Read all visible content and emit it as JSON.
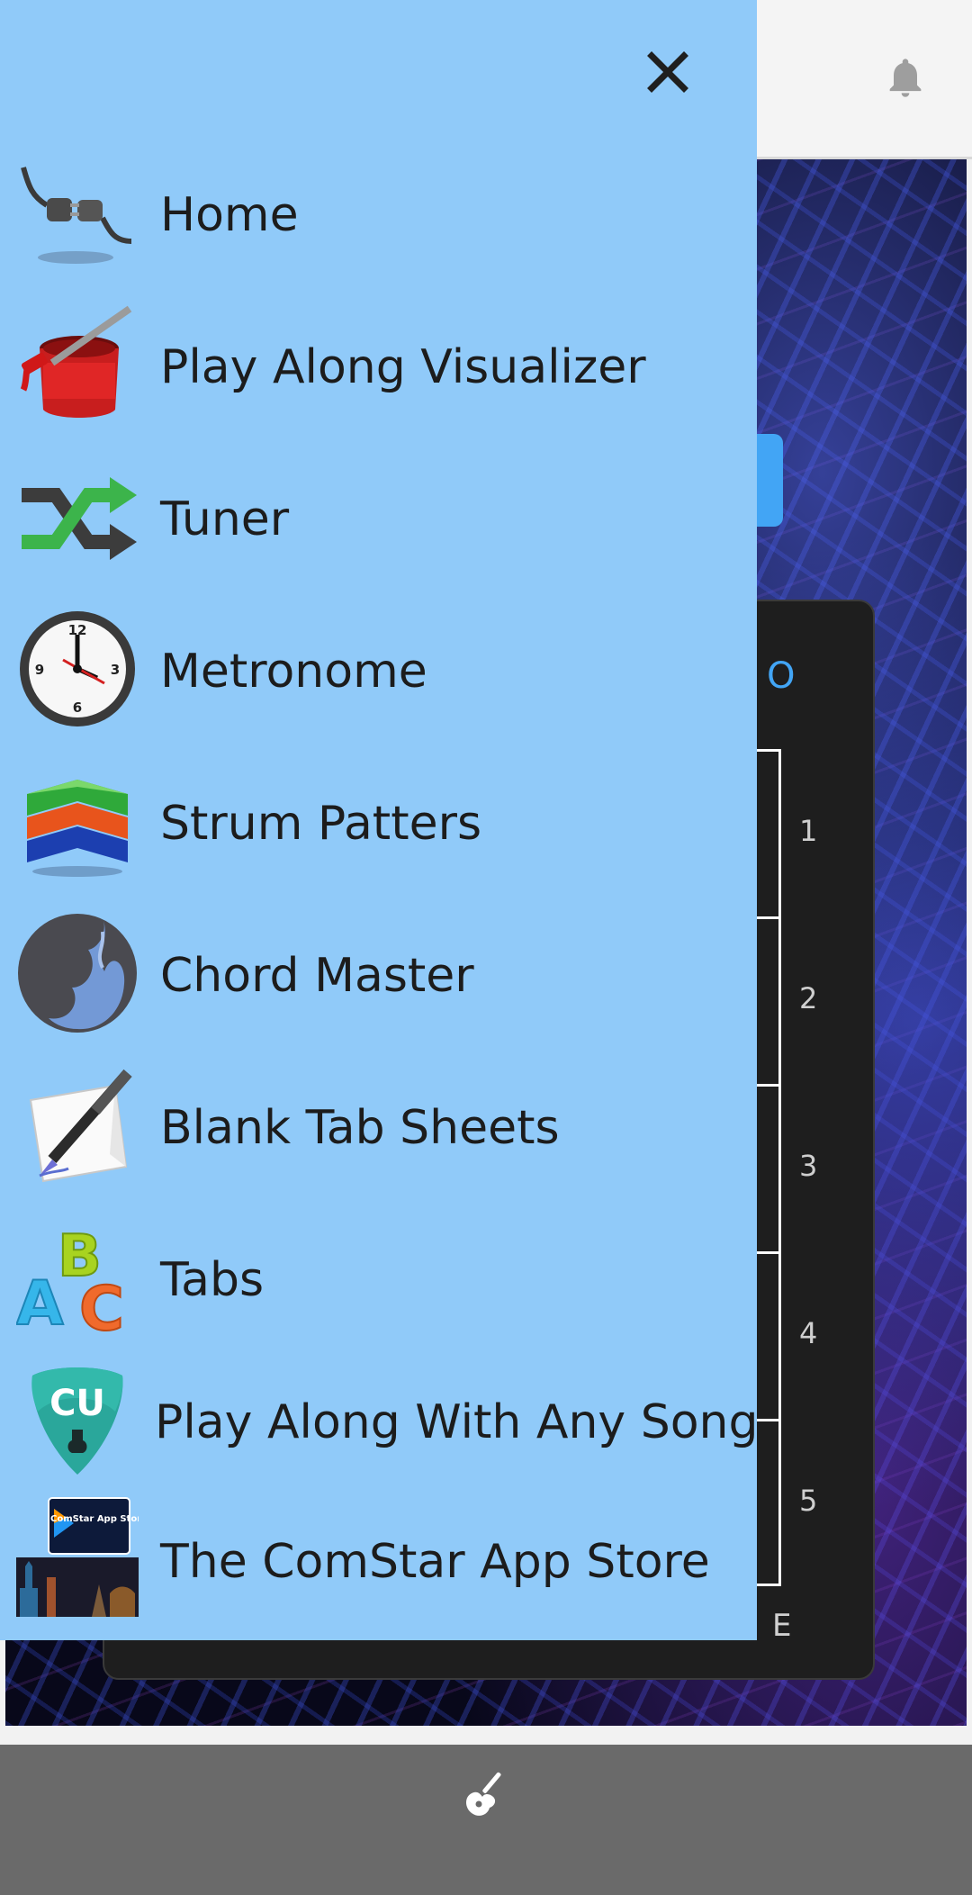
{
  "drawer": {
    "close_icon": "close-icon",
    "items": [
      {
        "label": "Home",
        "icon": "power-plug-icon"
      },
      {
        "label": "Play Along Visualizer",
        "icon": "paint-bucket-icon"
      },
      {
        "label": "Tuner",
        "icon": "shuffle-arrows-icon"
      },
      {
        "label": "Metronome",
        "icon": "clock-icon"
      },
      {
        "label": "Strum Patters",
        "icon": "chevron-stack-icon"
      },
      {
        "label": "Chord Master",
        "icon": "flame-icon"
      },
      {
        "label": "Blank Tab Sheets",
        "icon": "pen-paper-icon"
      },
      {
        "label": "Tabs",
        "icon": "abc-letters-icon"
      },
      {
        "label": "Play Along With Any Song",
        "icon": "guitar-pick-cu-icon"
      },
      {
        "label": "The ComStar App Store",
        "icon": "app-store-icon"
      }
    ],
    "app_store_badge": "ComStar App Store",
    "pick_letters": "CU",
    "clock_numbers": [
      "12",
      "3",
      "6",
      "9"
    ]
  },
  "background": {
    "card_heading_char": "O",
    "fret_numbers": [
      "1",
      "2",
      "3",
      "4",
      "5"
    ],
    "string_label": "E"
  },
  "colors": {
    "drawer_bg": "#90caf9",
    "accent_blue": "#42a5f5",
    "bottom_bar": "#6a6a6a"
  }
}
